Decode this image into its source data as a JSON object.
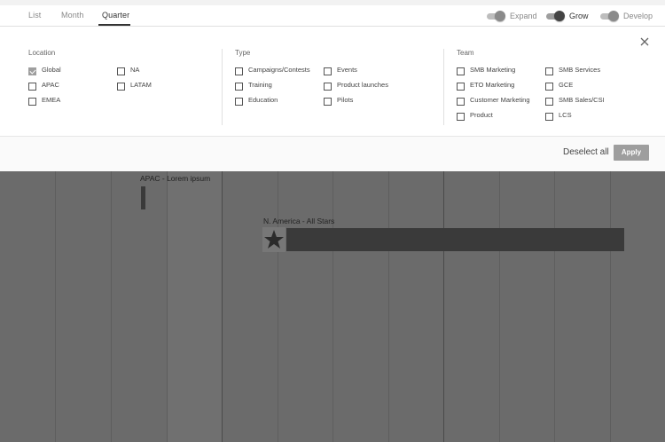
{
  "tabs": [
    {
      "label": "List",
      "active": false
    },
    {
      "label": "Month",
      "active": false
    },
    {
      "label": "Quarter",
      "active": true
    }
  ],
  "toggles": [
    {
      "label": "Expand",
      "on": false
    },
    {
      "label": "Grow",
      "on": true
    },
    {
      "label": "Develop",
      "on": false
    }
  ],
  "filters": {
    "location": {
      "title": "Location",
      "options": [
        {
          "label": "Global",
          "checked": true
        },
        {
          "label": "APAC",
          "checked": false
        },
        {
          "label": "EMEA",
          "checked": false
        },
        {
          "label": "NA",
          "checked": false
        },
        {
          "label": "LATAM",
          "checked": false
        }
      ]
    },
    "type": {
      "title": "Type",
      "options": [
        {
          "label": "Campaigns/Contests",
          "checked": false
        },
        {
          "label": "Training",
          "checked": false
        },
        {
          "label": "Education",
          "checked": false
        },
        {
          "label": "Events",
          "checked": false
        },
        {
          "label": "Product launches",
          "checked": false
        },
        {
          "label": "Pilots",
          "checked": false
        }
      ]
    },
    "team": {
      "title": "Team",
      "options": [
        {
          "label": "SMB Marketing",
          "checked": false
        },
        {
          "label": "ETO Marketing",
          "checked": false
        },
        {
          "label": "Customer Marketing",
          "checked": false
        },
        {
          "label": "Product",
          "checked": false
        },
        {
          "label": "SMB Services",
          "checked": false
        },
        {
          "label": "GCE",
          "checked": false
        },
        {
          "label": "SMB Sales/CSI",
          "checked": false
        },
        {
          "label": "LCS",
          "checked": false
        }
      ]
    }
  },
  "actions": {
    "deselect_all": "Deselect all",
    "apply": "Apply"
  },
  "timeline": {
    "events": [
      {
        "label": "APAC - Lorem ipsum"
      },
      {
        "label": "N. America - All Stars",
        "icon": "star-icon"
      }
    ]
  },
  "icons": {
    "close": "close-icon",
    "star": "star-icon"
  },
  "colors": {
    "overlay": "#6b6b6b",
    "bar": "#3a3a3a",
    "apply_button": "#9e9e9e"
  }
}
